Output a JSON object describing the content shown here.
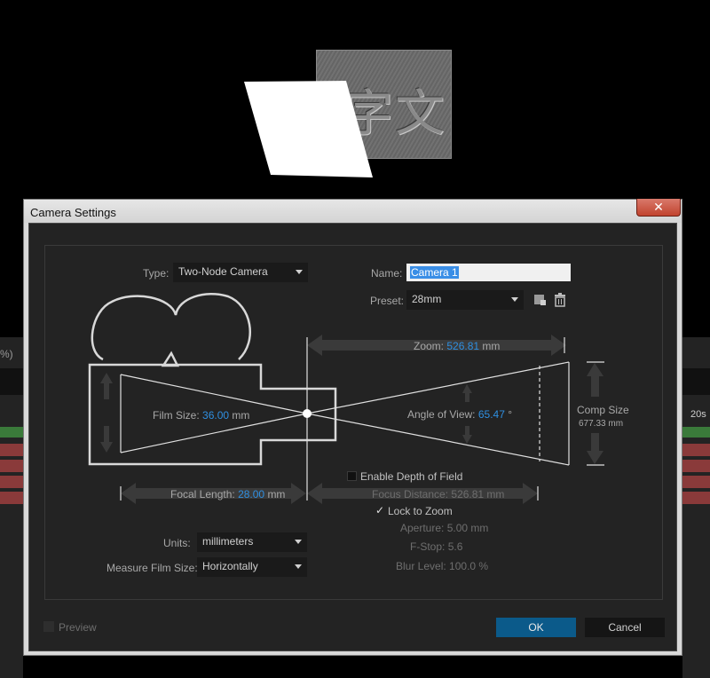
{
  "background": {
    "layer_glyphs": "字文",
    "timeline_zoom_fragment": "%)",
    "timeline_time_marker": "20s"
  },
  "dialog": {
    "title": "Camera Settings",
    "close_glyph": "✕",
    "type_label": "Type:",
    "type_value": "Two-Node Camera",
    "name_label": "Name:",
    "name_value": "Camera 1",
    "preset_label": "Preset:",
    "preset_value": "28mm",
    "zoom_label": "Zoom:",
    "zoom_value": "526.81",
    "zoom_unit": "mm",
    "film_size_label": "Film Size:",
    "film_size_value": "36.00",
    "film_size_unit": "mm",
    "angle_label": "Angle of View:",
    "angle_value": "65.47",
    "angle_unit": "°",
    "comp_size_label": "Comp Size",
    "comp_size_value": "677.33 mm",
    "focal_length_label": "Focal Length:",
    "focal_length_value": "28.00",
    "focal_length_unit": "mm",
    "dof_label": "Enable Depth of Field",
    "dof_checked": false,
    "focus_distance_label": "Focus Distance:",
    "focus_distance_value": "526.81 mm",
    "lock_zoom_label": "Lock to Zoom",
    "lock_zoom_checked": true,
    "aperture_label": "Aperture:",
    "aperture_value": "5.00 mm",
    "fstop_label": "F-Stop:",
    "fstop_value": "5.6",
    "blur_label": "Blur Level:",
    "blur_value": "100.0 %",
    "units_label": "Units:",
    "units_value": "millimeters",
    "measure_label": "Measure Film Size:",
    "measure_value": "Horizontally",
    "preview_label": "Preview",
    "preview_checked": false,
    "ok_label": "OK",
    "cancel_label": "Cancel",
    "check_glyph": "✓"
  },
  "colors": {
    "accent_blue": "#2f8fe0",
    "ok_button": "#0b5a8a",
    "dialog_bg": "#232323"
  },
  "icons": [
    "save-preset-icon",
    "delete-preset-icon",
    "camera-diagram-icon"
  ]
}
